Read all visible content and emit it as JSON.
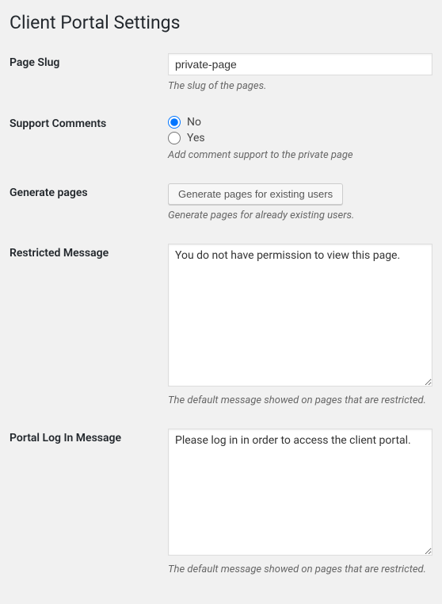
{
  "page": {
    "title": "Client Portal Settings"
  },
  "form": {
    "page_slug": {
      "label": "Page Slug",
      "value": "private-page",
      "description": "The slug of the pages."
    },
    "support_comments": {
      "label": "Support Comments",
      "options": {
        "no": "No",
        "yes": "Yes"
      },
      "selected": "no",
      "description": "Add comment support to the private page"
    },
    "generate_pages": {
      "label": "Generate pages",
      "button_label": "Generate pages for existing users",
      "description": "Generate pages for already existing users."
    },
    "restricted_message": {
      "label": "Restricted Message",
      "value": "You do not have permission to view this page.",
      "description": "The default message showed on pages that are restricted."
    },
    "login_message": {
      "label": "Portal Log In Message",
      "value": "Please log in in order to access the client portal.",
      "description": "The default message showed on pages that are restricted."
    }
  }
}
